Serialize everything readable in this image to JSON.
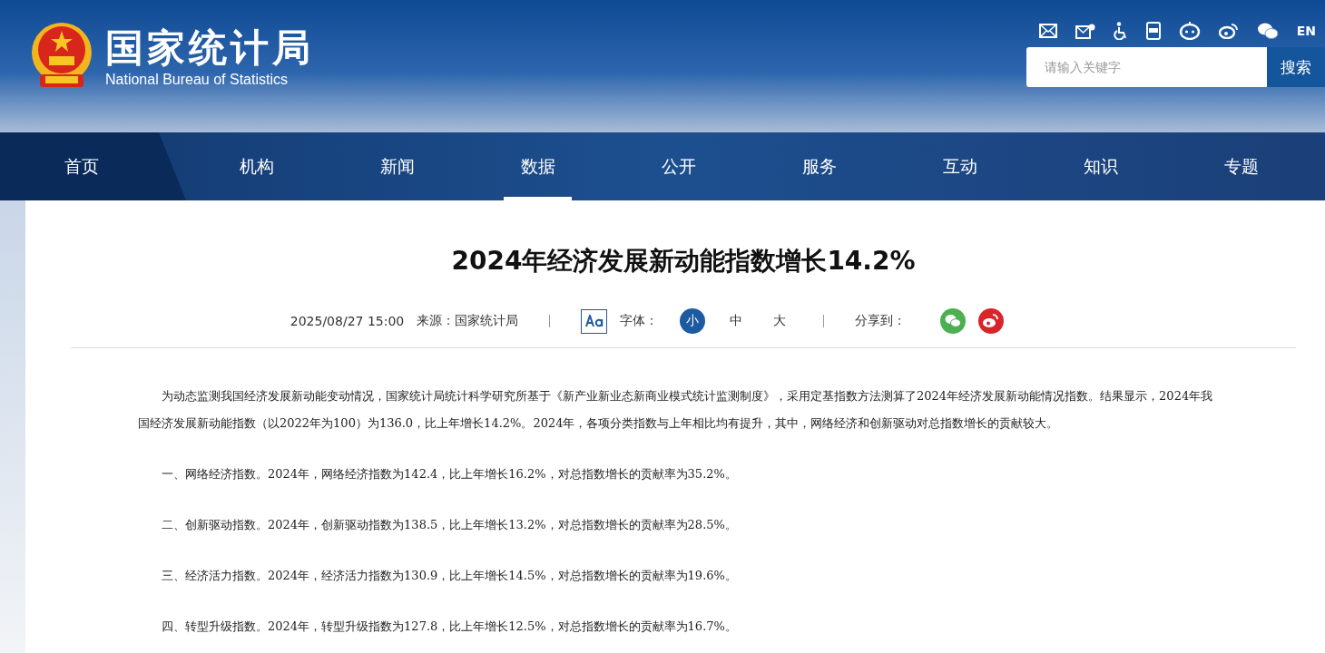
{
  "header": {
    "logo_title": "国家统计局",
    "logo_subtitle": "National Bureau of Statistics",
    "language_link": "EN",
    "search": {
      "placeholder": "请输入关键字",
      "button": "搜索"
    }
  },
  "nav": [
    {
      "label": "首页",
      "kind": "home",
      "selected": false
    },
    {
      "label": "机构",
      "kind": "link",
      "selected": false
    },
    {
      "label": "新闻",
      "kind": "link",
      "selected": false
    },
    {
      "label": "数据",
      "kind": "link",
      "selected": true
    },
    {
      "label": "公开",
      "kind": "link",
      "selected": false
    },
    {
      "label": "服务",
      "kind": "link",
      "selected": false
    },
    {
      "label": "互动",
      "kind": "link",
      "selected": false
    },
    {
      "label": "知识",
      "kind": "link",
      "selected": false
    },
    {
      "label": "专题",
      "kind": "link",
      "selected": false
    }
  ],
  "article": {
    "title": "2024年经济发展新动能指数增长14.2%",
    "date": "2025/08/27 15:00",
    "source": "来源：国家统计局",
    "font_label": "字体：",
    "font_sizes": [
      {
        "label": "小",
        "selected": true
      },
      {
        "label": "中",
        "selected": false
      },
      {
        "label": "大",
        "selected": false
      }
    ],
    "share_label": "分享到：",
    "paragraphs": [
      "为动态监测我国经济发展新动能变动情况，国家统计局统计科学研究所基于《新产业新业态新商业模式统计监测制度》，采用定基指数方法测算了2024年经济发展新动能情况指数。结果显示，2024年我国经济发展新动能指数（以2022年为100）为136.0，比上年增长14.2%。2024年，各项分类指数与上年相比均有提升，其中，网络经济和创新驱动对总指数增长的贡献较大。",
      "一、网络经济指数。2024年，网络经济指数为142.4，比上年增长16.2%，对总指数增长的贡献率为35.2%。",
      "二、创新驱动指数。2024年，创新驱动指数为138.5，比上年增长13.2%，对总指数增长的贡献率为28.5%。",
      "三、经济活力指数。2024年，经济活力指数为130.9，比上年增长14.5%，对总指数增长的贡献率为19.6%。",
      "四、转型升级指数。2024年，转型升级指数为127.8，比上年增长12.5%，对总指数增长的贡献率为16.7%。"
    ]
  }
}
